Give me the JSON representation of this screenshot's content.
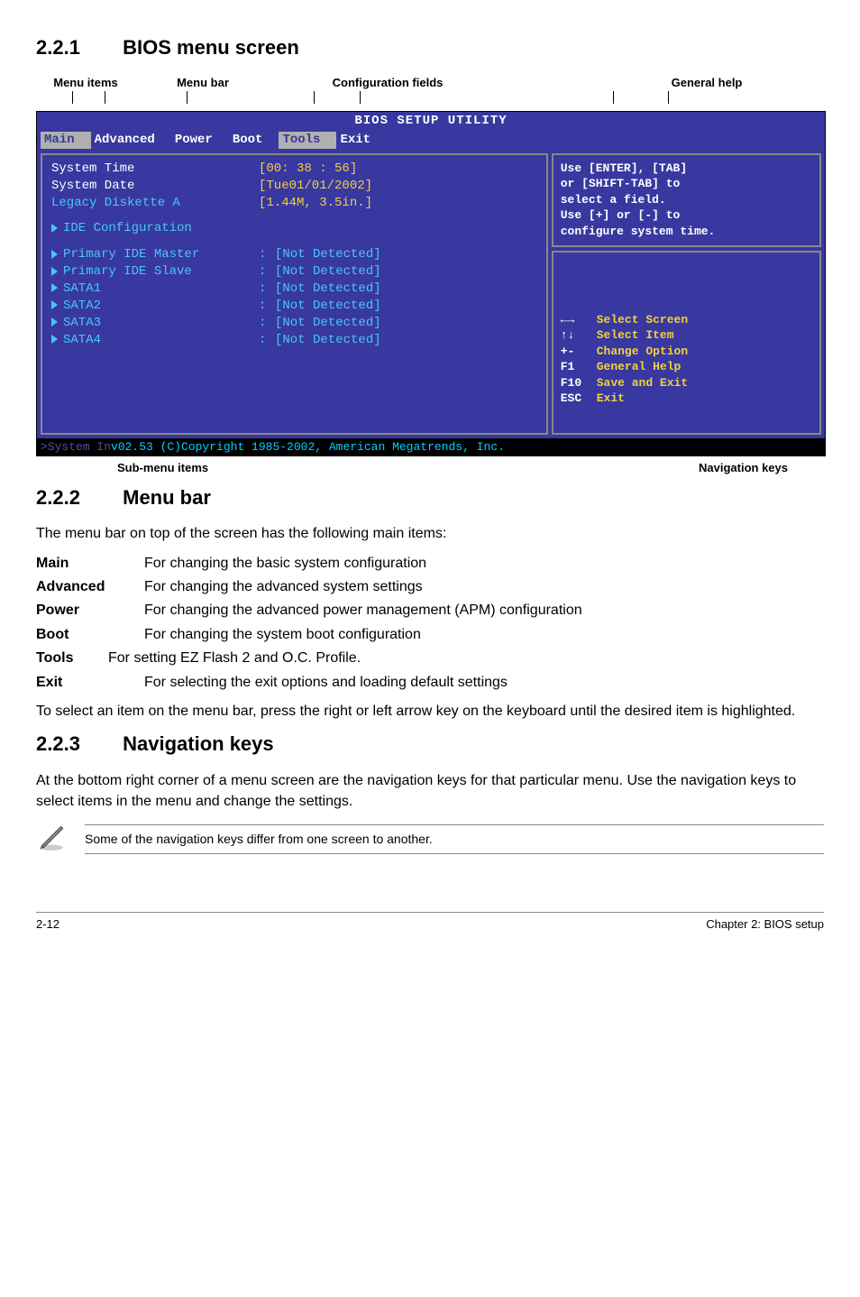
{
  "sections": {
    "s1": {
      "num": "2.2.1",
      "title": "BIOS menu screen"
    },
    "s2": {
      "num": "2.2.2",
      "title": "Menu bar"
    },
    "s3": {
      "num": "2.2.3",
      "title": "Navigation keys"
    }
  },
  "callouts": {
    "menu_items": "Menu items",
    "menu_bar": "Menu bar",
    "config_fields": "Configuration fields",
    "general_help": "General help",
    "submenu_items": "Sub-menu items",
    "nav_keys": "Navigation keys"
  },
  "bios": {
    "title": "BIOS SETUP UTILITY",
    "menubar": [
      "Main",
      "Advanced",
      "Power",
      "Boot",
      "Tools",
      "Exit"
    ],
    "menubar_selected": 0,
    "fields": {
      "system_time": {
        "label": "System Time",
        "value": "[00: 38 : 56]"
      },
      "system_date": {
        "label": "System Date",
        "value": "[Tue01/01/2002]"
      },
      "legacy_diskette": {
        "label": "Legacy Diskette A",
        "value": "[1.44M, 3.5in.]"
      }
    },
    "submenu": {
      "ide_config": "IDE Configuration"
    },
    "drives": [
      {
        "label": "Primary IDE Master",
        "value": "[Not Detected]"
      },
      {
        "label": "Primary IDE Slave",
        "value": "[Not Detected]"
      },
      {
        "label": "SATA1",
        "value": "[Not Detected]"
      },
      {
        "label": "SATA2",
        "value": "[Not Detected]"
      },
      {
        "label": "SATA3",
        "value": "[Not Detected]"
      },
      {
        "label": "SATA4",
        "value": "[Not Detected]"
      }
    ],
    "help": {
      "l1": "Use [ENTER], [TAB]",
      "l2": "or [SHIFT-TAB] to",
      "l3": "select a field.",
      "l4": "Use [+] or [-] to",
      "l5": "configure system time."
    },
    "nav": [
      {
        "key": "←→",
        "desc": "Select Screen"
      },
      {
        "key": "↑↓",
        "desc": "Select Item"
      },
      {
        "key": "+-",
        "desc": "Change Option"
      },
      {
        "key": "F1",
        "desc": "General Help"
      },
      {
        "key": "F10",
        "desc": "Save and Exit"
      },
      {
        "key": "ESC",
        "desc": "Exit"
      }
    ],
    "footer_prefix": "v02.53 (C)Copyright 1985-2002, American Megatrends, Inc."
  },
  "menubar_text": {
    "intro": "The menu bar on top of the screen has the following main items:",
    "defs": {
      "main": {
        "term": "Main",
        "desc": "For changing the basic system configuration"
      },
      "advanced": {
        "term": "Advanced",
        "desc": "For changing the advanced system settings"
      },
      "power": {
        "term": "Power",
        "desc": "For changing the advanced power management (APM) configuration"
      },
      "boot": {
        "term": "Boot",
        "desc": "For changing the system boot configuration"
      },
      "tools": {
        "term": "Tools",
        "desc": "For setting EZ Flash 2 and O.C. Profile."
      },
      "exit": {
        "term": "Exit",
        "desc": "For selecting the exit options and loading default settings"
      }
    },
    "outro": "To select an item on the menu bar, press the right or left arrow key on the keyboard until the desired item is highlighted."
  },
  "navkeys_text": {
    "p1": "At the bottom right corner of a menu screen are the navigation keys for that particular menu. Use the navigation keys to select items in the menu and change the settings.",
    "note": "Some of the navigation keys differ from one screen to another."
  },
  "footer": {
    "left": "2-12",
    "right": "Chapter 2: BIOS setup"
  }
}
